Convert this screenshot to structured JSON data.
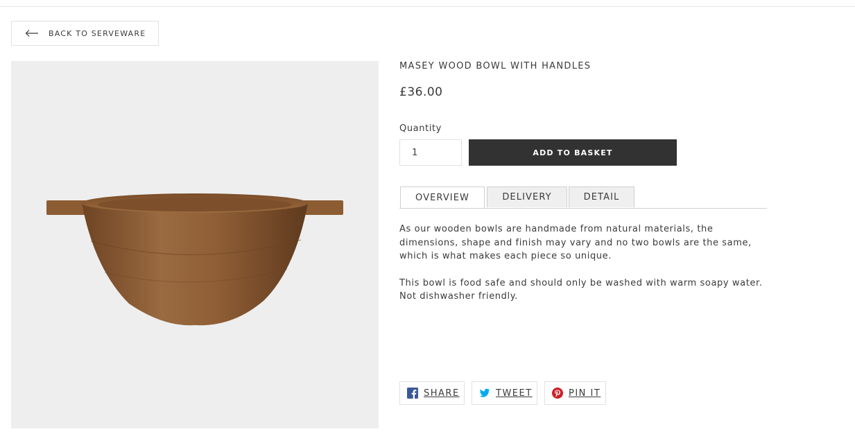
{
  "nav": {
    "back_label": "BACK TO SERVEWARE"
  },
  "product": {
    "title": "MASEY WOOD BOWL WITH HANDLES",
    "price": "£36.00",
    "quantity_label": "Quantity",
    "quantity_value": "1",
    "add_to_basket_label": "ADD TO BASKET",
    "image_alt": "Wooden bowl with handles"
  },
  "tabs": [
    {
      "label": "OVERVIEW",
      "active": true
    },
    {
      "label": "DELIVERY",
      "active": false
    },
    {
      "label": "DETAIL",
      "active": false
    }
  ],
  "description": {
    "paragraph_1": "As our wooden bowls are handmade from natural materials, the dimensions, shape and finish may vary and no two bowls are the same, which is what makes each piece so unique.",
    "paragraph_2": "This bowl is food safe and should only be washed with warm soapy water. Not dishwasher friendly."
  },
  "share": {
    "facebook_label": "SHARE",
    "twitter_label": "TWEET",
    "pinterest_label": "PIN IT"
  },
  "colors": {
    "button_dark": "#323232",
    "image_bg": "#eeeeee",
    "facebook": "#3b5998",
    "twitter": "#00aced",
    "pinterest": "#cb2027",
    "wood": "#8a5a33"
  },
  "icons": [
    "arrow-left-icon",
    "facebook-icon",
    "twitter-icon",
    "pinterest-icon"
  ]
}
